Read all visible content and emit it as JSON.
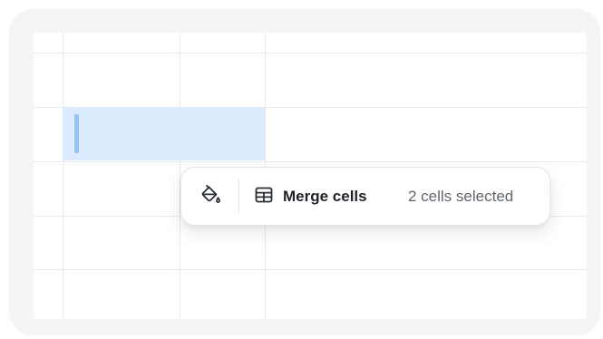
{
  "toolbar": {
    "fill_icon": "paint-bucket-icon",
    "merge_icon": "table-icon",
    "merge_label": "Merge cells",
    "status": "2 cells selected"
  },
  "colors": {
    "selection": "#dcebfd",
    "selection_cursor": "#93c2f6",
    "grid_line": "#e8eaec",
    "text_primary": "#1f2329",
    "text_muted": "#60666d"
  }
}
